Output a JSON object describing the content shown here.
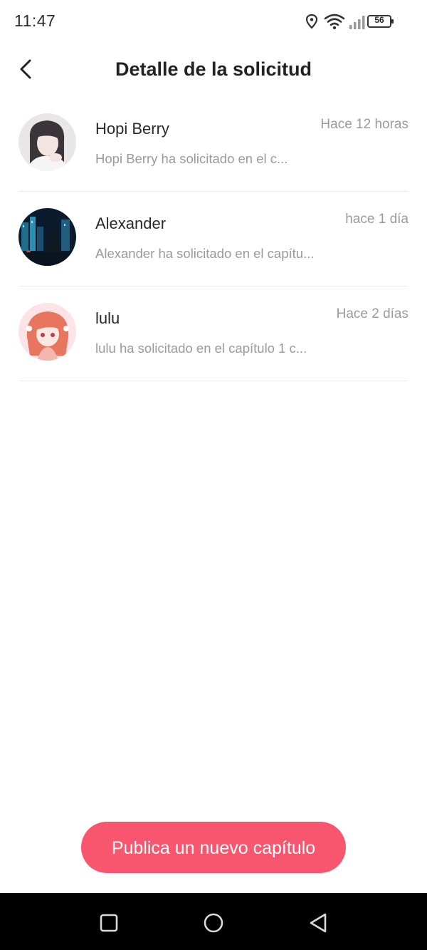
{
  "status_bar": {
    "time": "11:47",
    "battery_level": "56",
    "icons": [
      "location-icon",
      "wifi-icon",
      "signal-icon",
      "battery-icon"
    ]
  },
  "header": {
    "title": "Detalle de la solicitud",
    "back_icon": "chevron-left-icon"
  },
  "requests": [
    {
      "name": "Hopi Berry",
      "time": "Hace 12 horas",
      "snippet": "Hopi Berry ha solicitado en el c..."
    },
    {
      "name": "Alexander",
      "time": "hace 1 día",
      "snippet": "Alexander ha solicitado en el capítu..."
    },
    {
      "name": "lulu",
      "time": "Hace 2 días",
      "snippet": "lulu ha solicitado en el capítulo 1 c..."
    }
  ],
  "cta": {
    "label": "Publica un nuevo capítulo"
  },
  "colors": {
    "accent": "#f7566e",
    "muted_text": "#9a9a9a",
    "navbar": "#000000"
  },
  "nav_bar": {
    "icons": [
      "recents-square-icon",
      "home-circle-icon",
      "back-triangle-icon"
    ]
  }
}
